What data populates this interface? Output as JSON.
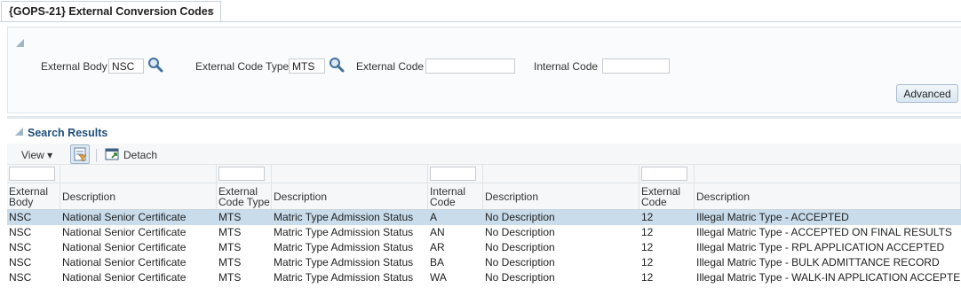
{
  "tab": {
    "title": "{GOPS-21} External Conversion Codes",
    "close": "×"
  },
  "search": {
    "fields": [
      {
        "label": "External Body",
        "value": "NSC"
      },
      {
        "label": "External Code Type",
        "value": "MTS"
      },
      {
        "label": "External Code",
        "value": ""
      },
      {
        "label": "Internal Code",
        "value": ""
      }
    ],
    "advanced_label": "Advanced"
  },
  "results": {
    "title": "Search Results",
    "toolbar": {
      "view_label": "View ▾",
      "detach_label": "Detach"
    },
    "columns": [
      {
        "label": "External Body"
      },
      {
        "label": "Description"
      },
      {
        "label": "External Code Type"
      },
      {
        "label": "Description"
      },
      {
        "label": "Internal Code"
      },
      {
        "label": "Description"
      },
      {
        "label": "External Code"
      },
      {
        "label": "Description"
      }
    ],
    "rows": [
      [
        "NSC",
        "National Senior Certificate",
        "MTS",
        "Matric Type Admission Status",
        "A",
        "No Description",
        "12",
        "Illegal Matric Type - ACCEPTED"
      ],
      [
        "NSC",
        "National Senior Certificate",
        "MTS",
        "Matric Type Admission Status",
        "AN",
        "No Description",
        "12",
        "Illegal Matric Type - ACCEPTED ON FINAL RESULTS"
      ],
      [
        "NSC",
        "National Senior Certificate",
        "MTS",
        "Matric Type Admission Status",
        "AR",
        "No Description",
        "12",
        "Illegal Matric Type - RPL APPLICATION ACCEPTED"
      ],
      [
        "NSC",
        "National Senior Certificate",
        "MTS",
        "Matric Type Admission Status",
        "BA",
        "No Description",
        "12",
        "Illegal Matric Type - BULK ADMITTANCE RECORD"
      ],
      [
        "NSC",
        "National Senior Certificate",
        "MTS",
        "Matric Type Admission Status",
        "WA",
        "No Description",
        "12",
        "Illegal Matric Type - WALK-IN APPLICATION ACCEPTED"
      ]
    ],
    "selected_row": 0
  },
  "colors": {
    "accent": "#1f4e79",
    "selected_row": "#c9dceb",
    "border": "#c9d2da"
  }
}
